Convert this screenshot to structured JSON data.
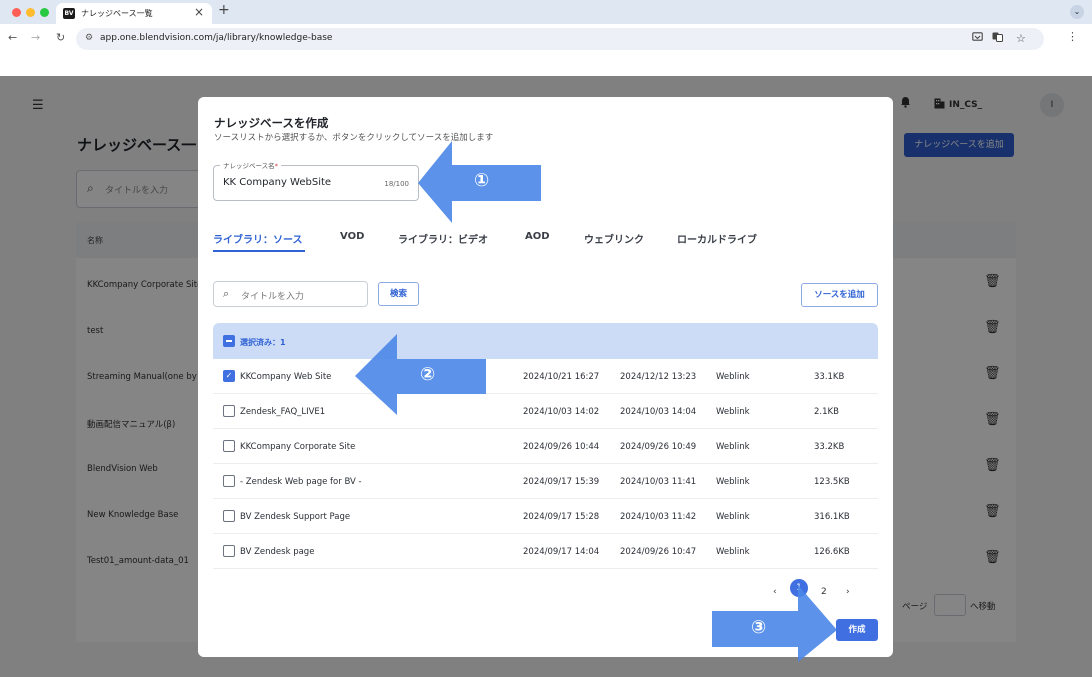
{
  "browser": {
    "tab_title": "ナレッジベース一覧",
    "favicon_text": "BV",
    "close_glyph": "×",
    "newtab_glyph": "+",
    "url": "app.one.blendvision.com/ja/library/knowledge-base"
  },
  "app": {
    "org_name": "IN_CS_",
    "avatar_initial": "I",
    "page_title": "ナレッジベース一",
    "search_placeholder": "タイトルを入力",
    "add_button": "ナレッジベースを追加",
    "table_header_name": "名称",
    "rows": [
      "KKCompany Corporate Site",
      "test",
      "Streaming Manual(one by",
      "動画配信マニュアル(β)",
      "BlendVision Web",
      "New Knowledge Base",
      "Test01_amount-data_01"
    ],
    "pager_page_label": "ページ",
    "pager_go_label": "へ移動"
  },
  "modal": {
    "title": "ナレッジベースを作成",
    "subtitle": "ソースリストから選択するか、ボタンをクリックしてソースを追加します",
    "kb_field": {
      "label": "ナレッジベース名",
      "required_mark": "*",
      "value": "KK Company WebSite",
      "counter": "18/100"
    },
    "tabs": [
      {
        "label": "ライブラリ：ソース",
        "active": true
      },
      {
        "label": "VOD",
        "active": false
      },
      {
        "label": "ライブラリ：ビデオ",
        "active": false
      },
      {
        "label": "AOD",
        "active": false
      },
      {
        "label": "ウェブリンク",
        "active": false
      },
      {
        "label": "ローカルドライブ",
        "active": false
      }
    ],
    "search_placeholder": "タイトルを入力",
    "search_button": "検索",
    "add_source_button": "ソースを追加",
    "selected_text": "選択済み：1",
    "sources": [
      {
        "name": "KKCompany Web Site",
        "created": "2024/10/21 16:27",
        "updated": "2024/12/12 13:23",
        "type": "Weblink",
        "size": "33.1KB",
        "checked": true
      },
      {
        "name": "Zendesk_FAQ_LIVE1",
        "created": "2024/10/03 14:02",
        "updated": "2024/10/03 14:04",
        "type": "Weblink",
        "size": "2.1KB",
        "checked": false
      },
      {
        "name": "KKCompany Corporate Site",
        "created": "2024/09/26 10:44",
        "updated": "2024/09/26 10:49",
        "type": "Weblink",
        "size": "33.2KB",
        "checked": false
      },
      {
        "name": "- Zendesk Web page for BV -",
        "created": "2024/09/17 15:39",
        "updated": "2024/10/03 11:41",
        "type": "Weblink",
        "size": "123.5KB",
        "checked": false
      },
      {
        "name": "BV Zendesk Support Page",
        "created": "2024/09/17 15:28",
        "updated": "2024/10/03 11:42",
        "type": "Weblink",
        "size": "316.1KB",
        "checked": false
      },
      {
        "name": "BV Zendesk page",
        "created": "2024/09/17 14:04",
        "updated": "2024/09/26 10:47",
        "type": "Weblink",
        "size": "126.6KB",
        "checked": false
      }
    ],
    "pagination": {
      "prev": "‹",
      "current": "1",
      "next_page": "2",
      "next": "›"
    },
    "create_button": "作成"
  },
  "callouts": [
    "①",
    "②",
    "③"
  ],
  "colors": {
    "accent": "#3f6fe0",
    "callout_arrow": "#4a86e8",
    "selected_header": "#cddcf6",
    "app_primary": "#2f5fd0"
  },
  "icons": {
    "search": "search-icon",
    "trash": "trash-icon",
    "bell": "bell-icon",
    "menu": "menu-icon",
    "check": "check-icon",
    "building": "building-icon"
  }
}
